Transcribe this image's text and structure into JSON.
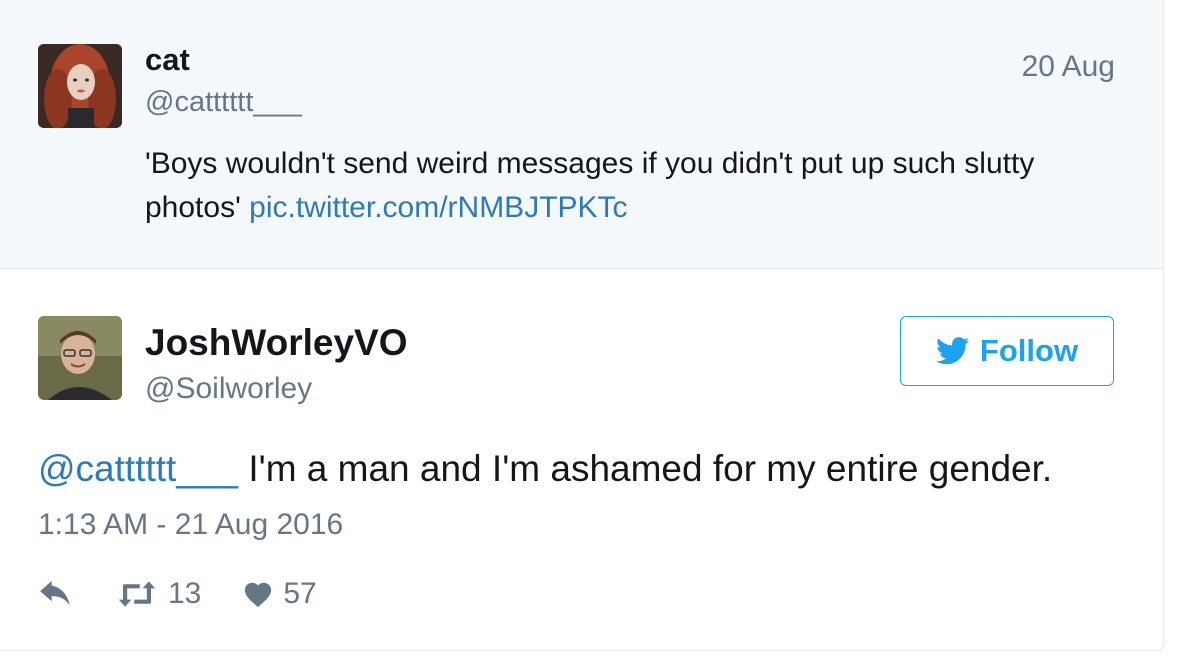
{
  "quoted_tweet": {
    "name": "cat",
    "handle": "@catttttt___",
    "date": "20 Aug",
    "text": "'Boys wouldn't send weird messages if you didn't put up such slutty photos'",
    "link": "pic.twitter.com/rNMBJTPKTc"
  },
  "reply_tweet": {
    "name": "JoshWorleyVO",
    "handle": "@Soilworley",
    "follow_label": "Follow",
    "mention": "@catttttt___",
    "text": "I'm a man and I'm ashamed for my entire gender.",
    "timestamp": "1:13 AM - 21 Aug 2016",
    "retweet_count": "13",
    "like_count": "57"
  },
  "colors": {
    "accent": "#1da1f2",
    "link": "#2b7bb9",
    "text": "#14171a",
    "muted": "#657786",
    "parent_bg": "#f5f8fa"
  },
  "icons": [
    "twitter-bird-icon",
    "reply-icon",
    "retweet-icon",
    "heart-icon"
  ]
}
